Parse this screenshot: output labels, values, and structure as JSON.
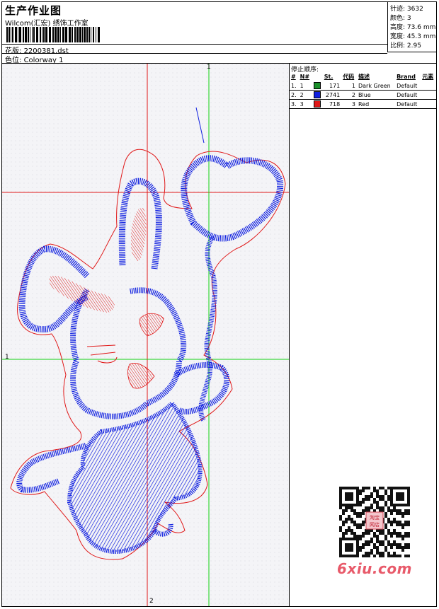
{
  "header": {
    "title": "生产作业图",
    "studio": "Wilcom(汇宏) 绣饰工作室",
    "design_label": "花版:",
    "design_value": "2200381.dst",
    "color_label": "色位:",
    "color_value": "Colorway 1"
  },
  "stats": [
    {
      "label": "针迹:",
      "value": "3632"
    },
    {
      "label": "颜色:",
      "value": "3"
    },
    {
      "label": "高度:",
      "value": "73.6 mm"
    },
    {
      "label": "宽度:",
      "value": "45.3 mm"
    },
    {
      "label": "比例:",
      "value": "2.95"
    }
  ],
  "stop_sequence": {
    "title": "停止顺序:",
    "columns": [
      "#",
      "N#",
      "St.",
      "代码",
      "描述",
      "Brand",
      "元素"
    ],
    "rows": [
      {
        "index": "1.",
        "needle": "1",
        "color": "#1a8f2a",
        "stitches": "171",
        "code": "1",
        "desc": "Dark Green",
        "brand": "Default"
      },
      {
        "index": "2.",
        "needle": "2",
        "color": "#1020e0",
        "stitches": "2741",
        "code": "2",
        "desc": "Blue",
        "brand": "Default"
      },
      {
        "index": "3.",
        "needle": "3",
        "color": "#e01818",
        "stitches": "718",
        "code": "3",
        "desc": "Red",
        "brand": "Default"
      }
    ]
  },
  "axes": {
    "top": "1",
    "left": "1",
    "bottom": "2"
  },
  "watermark": "6xiu.com",
  "qr_badge": "淘宝\n网店"
}
